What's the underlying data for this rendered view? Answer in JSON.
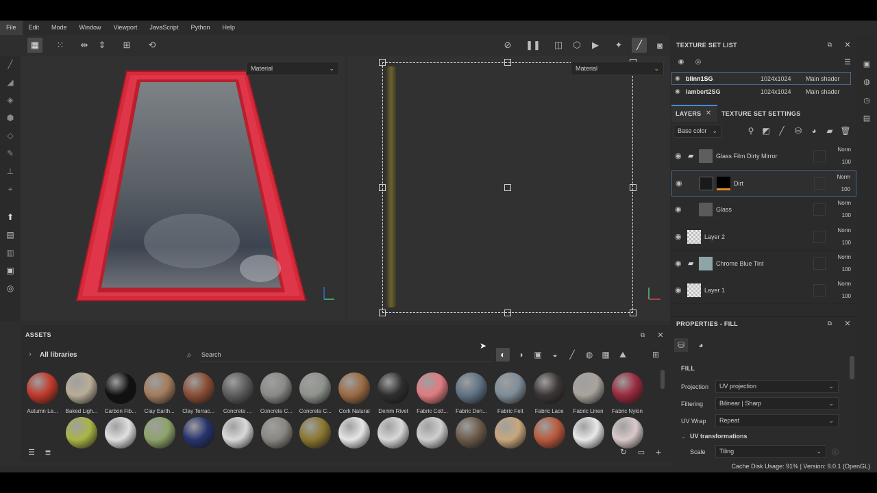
{
  "menu": [
    "File",
    "Edit",
    "Mode",
    "Window",
    "Viewport",
    "JavaScript",
    "Python",
    "Help"
  ],
  "viewport3d": {
    "dropdown": "Material"
  },
  "viewport2d": {
    "dropdown": "Material"
  },
  "assets": {
    "title": "ASSETS",
    "breadcrumb": "All libraries",
    "search_placeholder": "Search",
    "row1": [
      {
        "label": "Autumn Le...",
        "color": "#c0392b"
      },
      {
        "label": "Baked Ligh...",
        "color": "#b8ad98"
      },
      {
        "label": "Carbon Fib...",
        "color": "#111111"
      },
      {
        "label": "Clay Earth...",
        "color": "#a27c5c"
      },
      {
        "label": "Clay Terrac...",
        "color": "#8a4d34"
      },
      {
        "label": "Concrete ...",
        "color": "#5c5c5c"
      },
      {
        "label": "Concrete C...",
        "color": "#8a8a88"
      },
      {
        "label": "Concrete C...",
        "color": "#8e938c"
      },
      {
        "label": "Cork Natural",
        "color": "#9b6a43"
      },
      {
        "label": "Denim Rivet",
        "color": "#2e2e2e"
      },
      {
        "label": "Fabric Cott...",
        "color": "#e07b80"
      },
      {
        "label": "Fabric Den...",
        "color": "#5f7284"
      },
      {
        "label": "Fabric Felt",
        "color": "#7f8c98"
      },
      {
        "label": "Fabric Lace",
        "color": "#3d3535"
      },
      {
        "label": "Fabric Linen",
        "color": "#a8a49c"
      },
      {
        "label": "Fabric Nylon",
        "color": "#9a2a3e"
      }
    ],
    "row2_colors": [
      "#a9b545",
      "#e0e0e0",
      "#8ea36a",
      "#28336e",
      "#d9d9d9",
      "#8a8782",
      "#8a7630",
      "#e6e6e6",
      "#d8d8d8",
      "#cfcfcf",
      "#6b5a4a",
      "#c8a77d",
      "#b8593c",
      "#e8e8e8",
      "#d9c9c9"
    ]
  },
  "texture_set_list": {
    "title": "TEXTURE SET LIST",
    "rows": [
      {
        "name": "blinn1SG",
        "size": "1024x1024",
        "shader": "Main shader"
      },
      {
        "name": "lambert2SG",
        "size": "1024x1024",
        "shader": "Main shader"
      }
    ]
  },
  "layers_panel": {
    "tab_layers": "LAYERS",
    "tab_settings": "TEXTURE SET SETTINGS",
    "channel": "Base color",
    "layers": [
      {
        "name": "Glass Film Dirty Mirror",
        "blend": "Norm",
        "opacity": "100",
        "folder": true
      },
      {
        "name": "Dirt",
        "blend": "Norm",
        "opacity": "100",
        "folder": false
      },
      {
        "name": "Glass",
        "blend": "Norm",
        "opacity": "100",
        "folder": false
      },
      {
        "name": "Layer 2",
        "blend": "Norm",
        "opacity": "100",
        "folder": false
      },
      {
        "name": "Chrome Blue Tint",
        "blend": "Norm",
        "opacity": "100",
        "folder": true
      },
      {
        "name": "Layer 1",
        "blend": "Norm",
        "opacity": "100",
        "folder": false
      }
    ]
  },
  "properties": {
    "title": "PROPERTIES - FILL",
    "section": "FILL",
    "projection_label": "Projection",
    "projection_value": "UV projection",
    "filtering_label": "Filtering",
    "filtering_value": "Bilinear | Sharp",
    "uvwrap_label": "UV Wrap",
    "uvwrap_value": "Repeat",
    "uv_transforms": "UV transformations",
    "scale_label": "Scale",
    "scale_value": "Tiling"
  },
  "status": "Cache Disk Usage:   91% | Version: 9.0.1 (OpenGL)"
}
